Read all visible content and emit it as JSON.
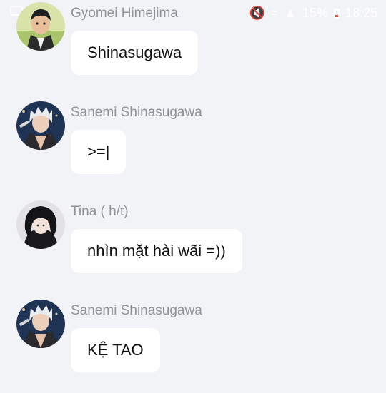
{
  "status_bar": {
    "battery_percent": "15%",
    "time": "18:25",
    "icons": [
      "mute-icon",
      "wifi-icon",
      "signal-icon",
      "battery-icon"
    ]
  },
  "messages": [
    {
      "sender": "Gyomei Himejima",
      "text": "Shinasugawa",
      "avatar": "gyomei-avatar"
    },
    {
      "sender": "Sanemi Shinasugawa",
      "text": ">=|",
      "avatar": "sanemi-avatar"
    },
    {
      "sender": "Tina ( h/t)",
      "text": "nhìn mặt hài wãi =))",
      "avatar": "tina-avatar"
    },
    {
      "sender": "Sanemi Shinasugawa",
      "text": "KỆ TAO",
      "avatar": "sanemi-avatar"
    }
  ],
  "colors": {
    "background": "#f2f3f7",
    "bubble": "#ffffff",
    "sender_name": "#8f9296",
    "message_text": "#111111"
  }
}
